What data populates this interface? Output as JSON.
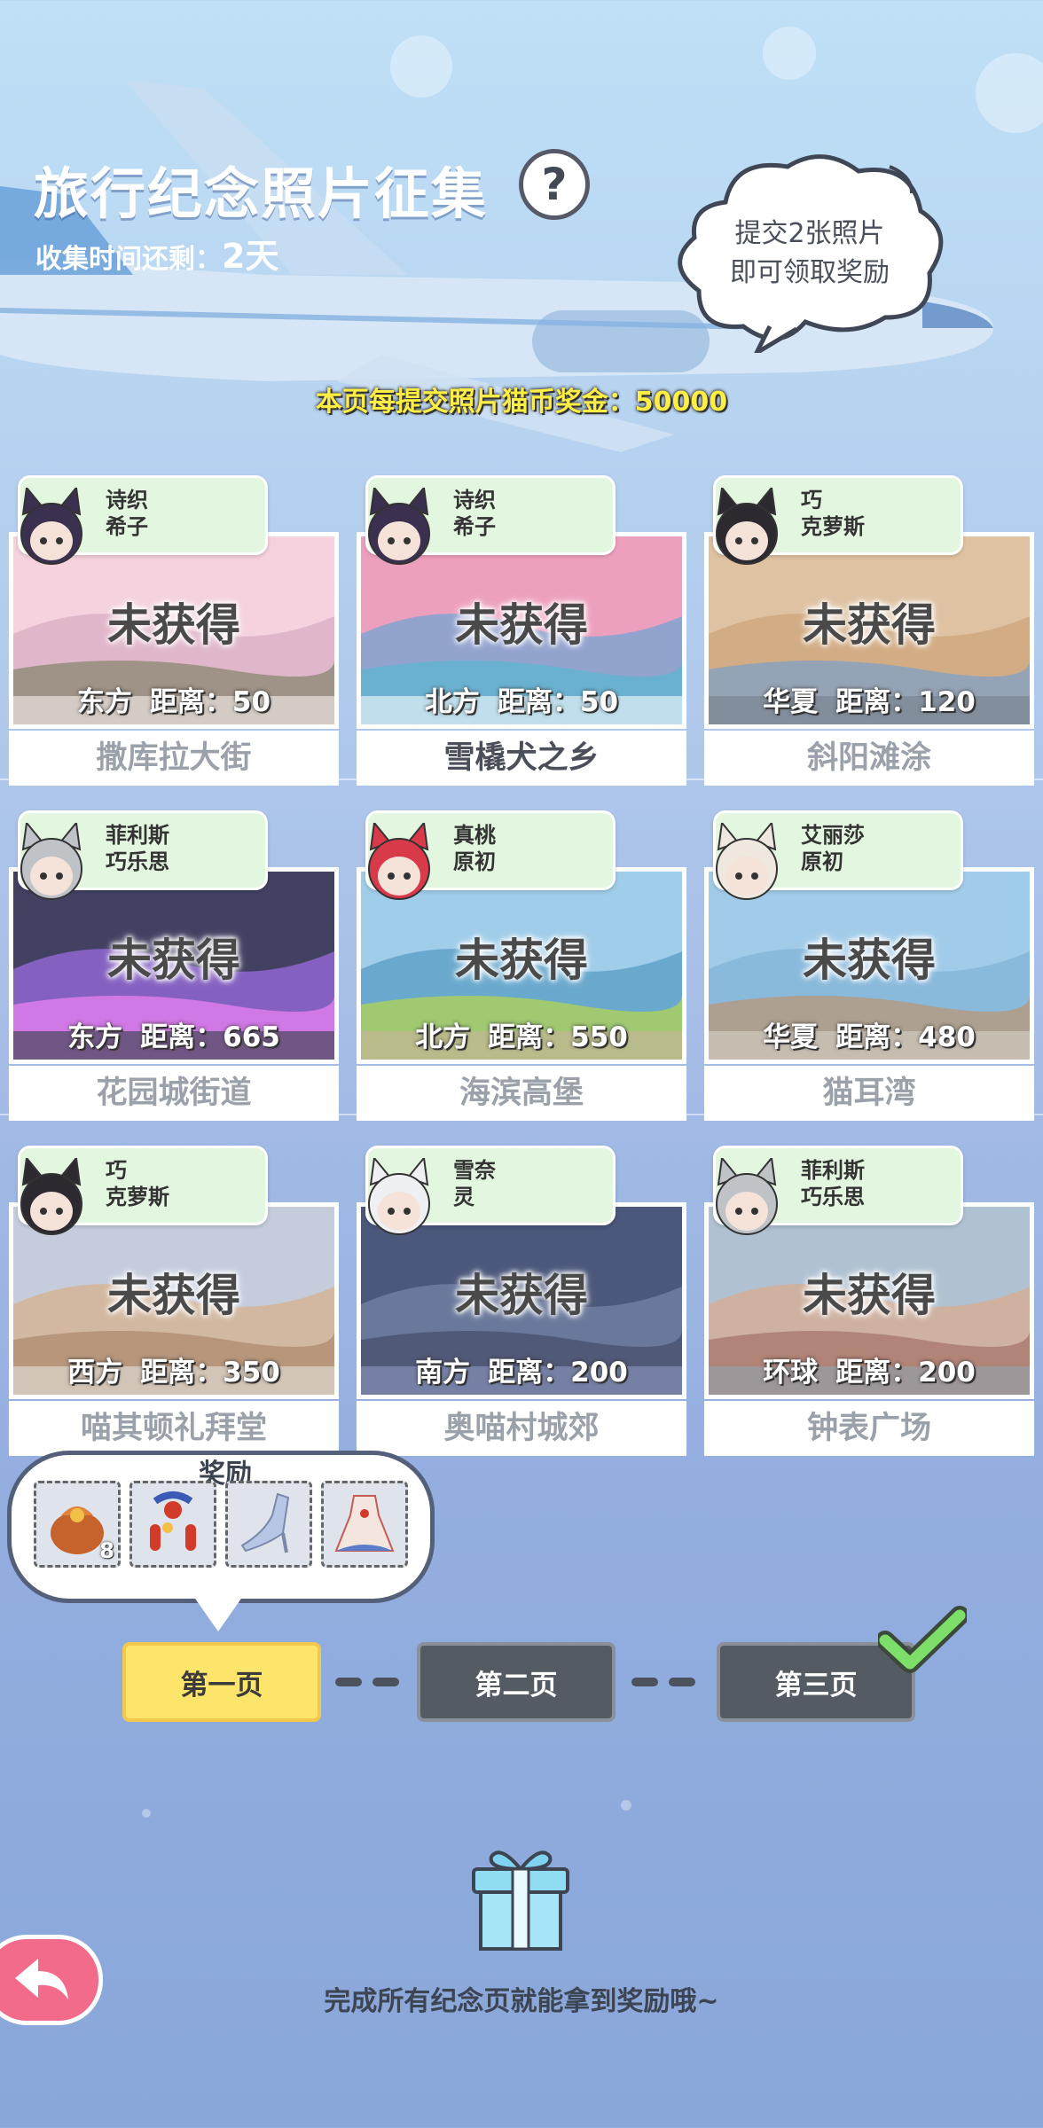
{
  "header": {
    "title": "旅行纪念照片征集",
    "help_symbol": "?",
    "remaining_label": "收集时间还剩：",
    "remaining_value": "2天",
    "bubble_line1": "提交2张照片",
    "bubble_line2": "即可领取奖励",
    "bonus_text": "本页每提交照片猫币奖金：50000"
  },
  "cards": [
    {
      "char1": "诗织",
      "char2": "希子",
      "status": "未获得",
      "direction": "东方",
      "distance": "距离：50",
      "name": "撒库拉大街"
    },
    {
      "char1": "诗织",
      "char2": "希子",
      "status": "未获得",
      "direction": "北方",
      "distance": "距离：50",
      "name": "雪橇犬之乡"
    },
    {
      "char1": "巧",
      "char2": "克萝斯",
      "status": "未获得",
      "direction": "华夏",
      "distance": "距离：120",
      "name": "斜阳滩涂"
    },
    {
      "char1": "菲利斯",
      "char2": "巧乐思",
      "status": "未获得",
      "direction": "东方",
      "distance": "距离：665",
      "name": "花园城街道"
    },
    {
      "char1": "真桃",
      "char2": "原初",
      "status": "未获得",
      "direction": "北方",
      "distance": "距离：550",
      "name": "海滨高堡"
    },
    {
      "char1": "艾丽莎",
      "char2": "原初",
      "status": "未获得",
      "direction": "华夏",
      "distance": "距离：480",
      "name": "猫耳湾"
    },
    {
      "char1": "巧",
      "char2": "克萝斯",
      "status": "未获得",
      "direction": "西方",
      "distance": "距离：350",
      "name": "喵其顿礼拜堂"
    },
    {
      "char1": "雪奈",
      "char2": "灵",
      "status": "未获得",
      "direction": "南方",
      "distance": "距离：200",
      "name": "奥喵村城郊"
    },
    {
      "char1": "菲利斯",
      "char2": "巧乐思",
      "status": "未获得",
      "direction": "环球",
      "distance": "距离：200",
      "name": "钟表广场"
    }
  ],
  "rewards": {
    "title": "奖励",
    "items": [
      {
        "icon": "treasure-bag-icon",
        "count": "8"
      },
      {
        "icon": "red-lantern-ornament-icon",
        "count": ""
      },
      {
        "icon": "crystal-shoe-icon",
        "count": ""
      },
      {
        "icon": "dress-outfit-icon",
        "count": ""
      }
    ]
  },
  "pages": {
    "page1": "第一页",
    "page2": "第二页",
    "page3": "第三页"
  },
  "footer": {
    "complete_text": "完成所有纪念页就能拿到奖励哦~"
  },
  "colors": {
    "active_page": "#fde46b",
    "inactive_page": "#555b63",
    "tag_bg": "#e3f6df",
    "bonus_text": "#ffee44",
    "back_button": "#f26b8b"
  }
}
